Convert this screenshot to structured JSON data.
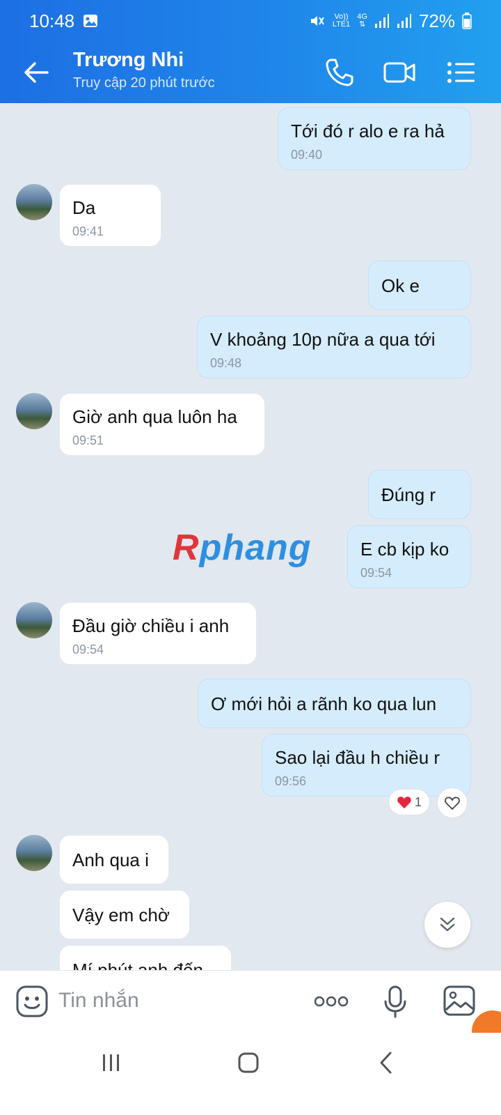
{
  "status_bar": {
    "time": "10:48",
    "net_top": "Vo))",
    "net_bottom": "LTE1",
    "net_type": "4G",
    "battery": "72%"
  },
  "header": {
    "contact_name": "Trương Nhi",
    "last_seen": "Truy cập 20 phút trước"
  },
  "messages": [
    {
      "dir": "out",
      "text": "Tới đó r alo e ra hả",
      "time": "09:40"
    },
    {
      "dir": "in",
      "text": "Da",
      "time": "09:41"
    },
    {
      "dir": "out",
      "text": "Ok e",
      "time": ""
    },
    {
      "dir": "out",
      "text": "V khoảng 10p nữa a qua tới",
      "time": "09:48"
    },
    {
      "dir": "in",
      "text": "Giờ anh qua luôn ha",
      "time": "09:51"
    },
    {
      "dir": "out",
      "text": "Đúng r",
      "time": ""
    },
    {
      "dir": "out",
      "text": "E cb kịp ko",
      "time": "09:54"
    },
    {
      "dir": "in",
      "text": "Đầu giờ chiều i anh",
      "time": "09:54"
    },
    {
      "dir": "out",
      "text": "Ơ mới hỏi a rãnh ko qua lun",
      "time": ""
    },
    {
      "dir": "out",
      "text": "Sao lại đầu h chiều r",
      "time": "09:56"
    },
    {
      "dir": "in",
      "text": "Anh qua i",
      "time": ""
    },
    {
      "dir": "in",
      "text": "Vậy em chờ",
      "time": ""
    },
    {
      "dir": "in",
      "text": "Mí phút anh đến",
      "time": ""
    }
  ],
  "reaction": {
    "count": "1"
  },
  "watermark": {
    "first": "R",
    "rest": "phang"
  },
  "input": {
    "placeholder": "Tin nhắn"
  },
  "colors": {
    "header_start": "#1d6fe3",
    "header_end": "#22a0ef",
    "out_bubble": "#d5ecfc",
    "in_bubble": "#ffffff"
  }
}
